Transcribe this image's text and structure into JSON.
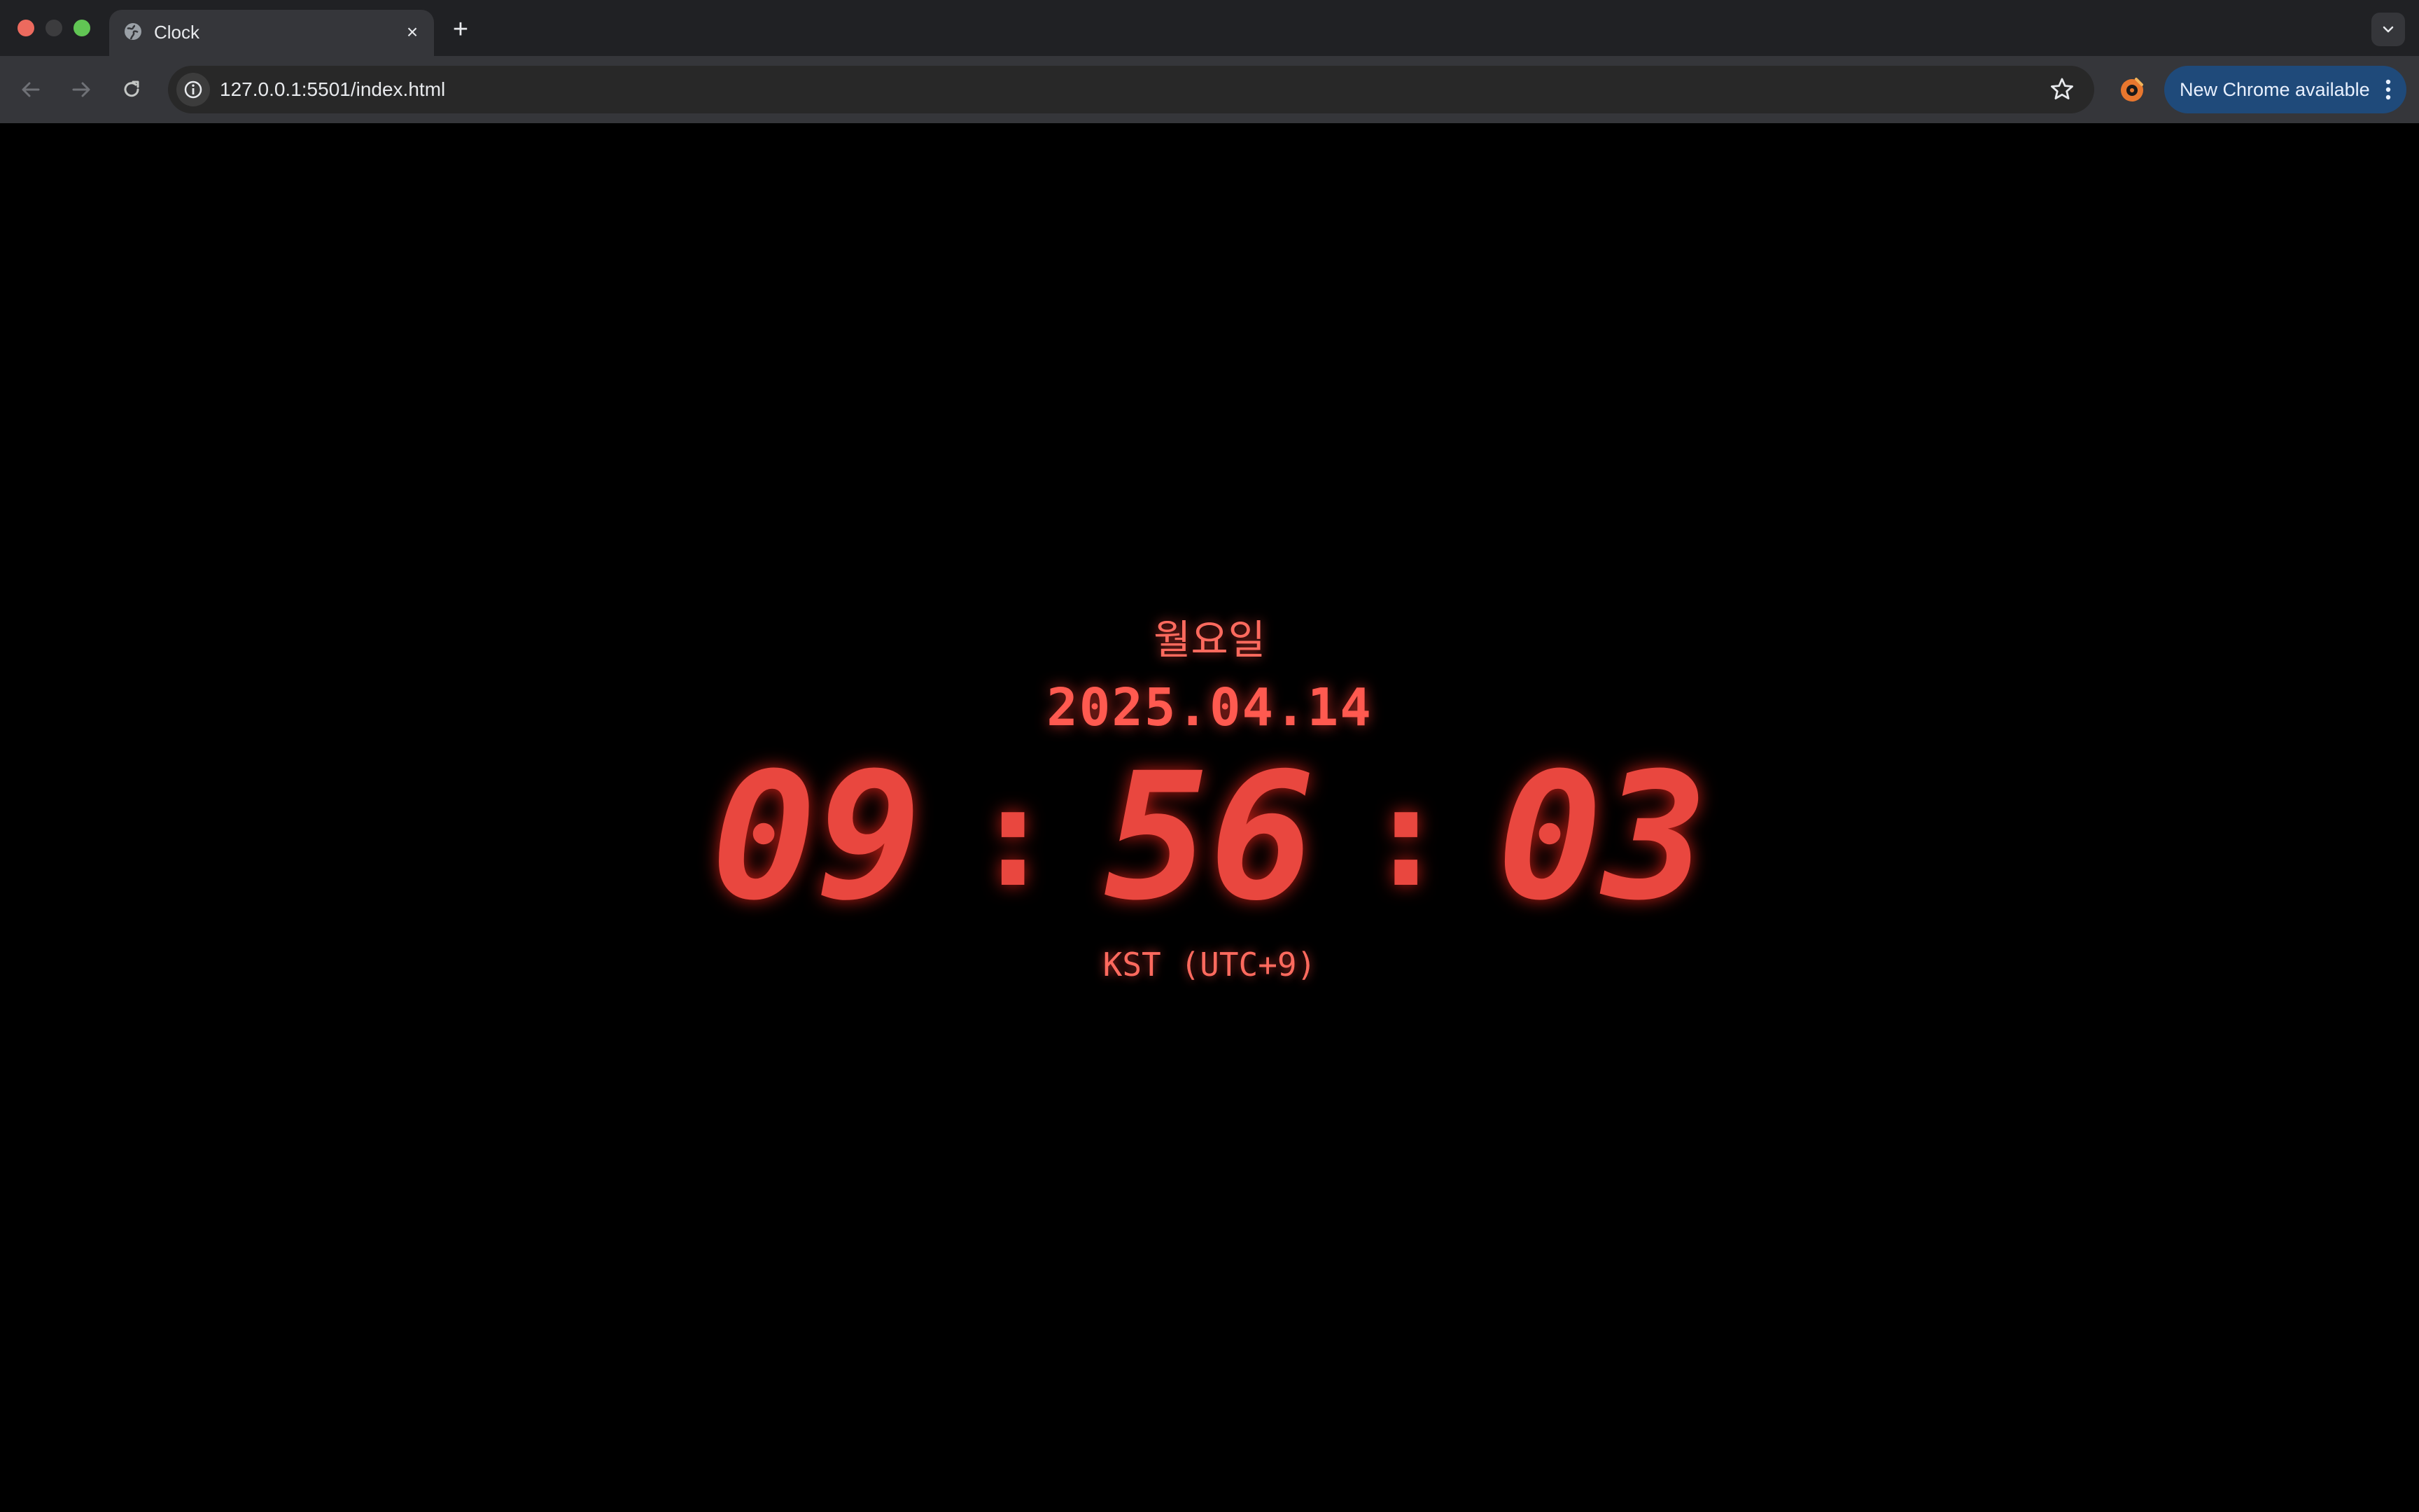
{
  "tab": {
    "title": "Clock",
    "favicon": "globe-icon",
    "close": "×",
    "new_tab": "+"
  },
  "toolbar": {
    "url": "127.0.0.1:5501/index.html",
    "update_label": "New Chrome available"
  },
  "clock": {
    "weekday": "월요일",
    "date": "2025.04.14",
    "hours": "09",
    "minutes": "56",
    "seconds": "03",
    "separator": ":",
    "timezone": "KST (UTC+9)"
  },
  "colors": {
    "accent": "#e9473f",
    "background": "#000000",
    "chrome_dark": "#202124",
    "update_pill": "#1f4a7a"
  }
}
